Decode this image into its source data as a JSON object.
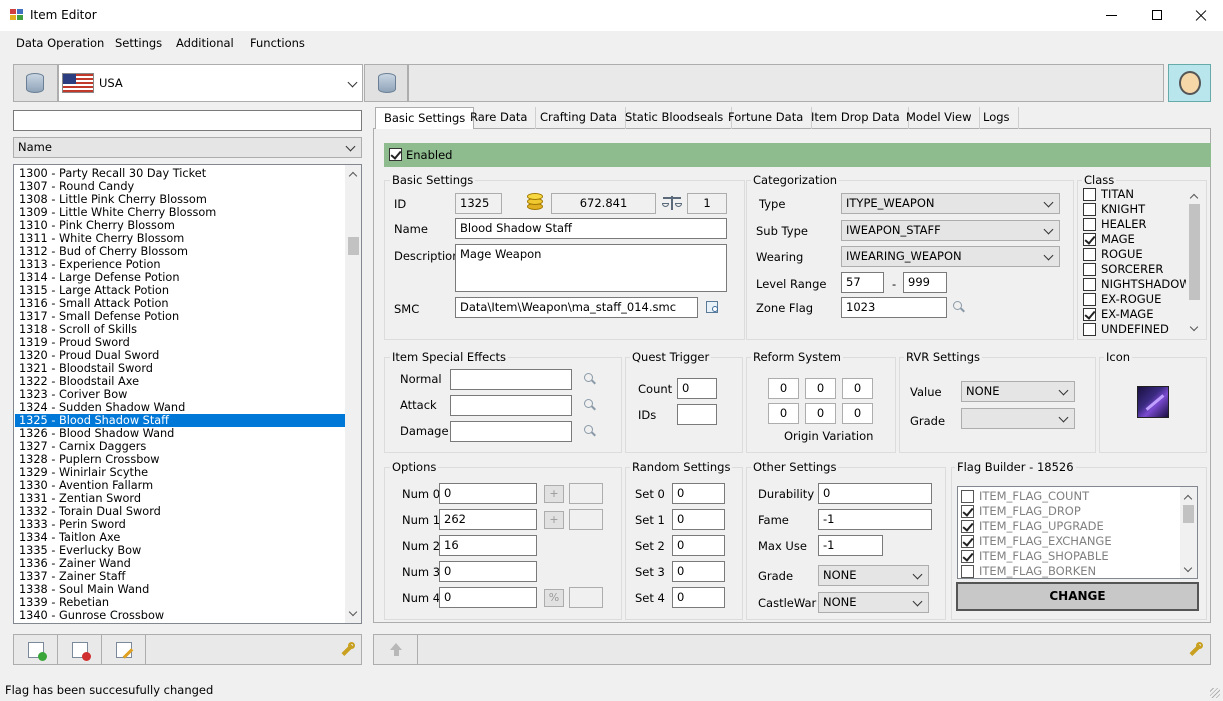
{
  "window": {
    "title": "Item Editor"
  },
  "menu": {
    "items": [
      "Data Operation",
      "Settings",
      "Additional",
      "Functions"
    ]
  },
  "toolbar": {
    "region": "USA"
  },
  "search": {
    "value": ""
  },
  "sort": {
    "selected": "Name"
  },
  "items": [
    "1300 - Party Recall 30 Day Ticket",
    "1307 - Round Candy",
    "1308 - Little Pink Cherry Blossom",
    "1309 - Little White Cherry Blossom",
    "1310 - Pink Cherry Blossom",
    "1311 - White Cherry Blossom",
    "1312 - Bud of Cherry Blossom",
    "1313 - Experience Potion",
    "1314 - Large Defense Potion",
    "1315 - Large Attack Potion",
    "1316 - Small Attack Potion",
    "1317 - Small Defense Potion",
    "1318 - Scroll of Skills",
    "1319 - Proud Sword",
    "1320 - Proud Dual Sword",
    "1321 - Bloodstail Sword",
    "1322 - Bloodstail Axe",
    "1323 - Coriver Bow",
    "1324 - Sudden Shadow Wand",
    "1325 - Blood Shadow Staff",
    "1326 - Blood Shadow Wand",
    "1327 - Carnix Daggers",
    "1328 - Puplern Crossbow",
    "1329 - Winirlair Scythe",
    "1330 - Avention Fallarm",
    "1331 - Zentian Sword",
    "1332 - Torain Dual Sword",
    "1333 - Perin Sword",
    "1334 - Taitlon Axe",
    "1335 - Everlucky Bow",
    "1336 - Zainer Wand",
    "1337 - Zainer Staff",
    "1338 - Soul Main Wand",
    "1339 - Rebetian",
    "1340 - Gunrose Crossbow"
  ],
  "selected_item_index": 19,
  "tabs": [
    "Basic Settings",
    "Rare Data",
    "Crafting Data",
    "Static Bloodseals",
    "Fortune Data",
    "Item Drop Data",
    "Model View",
    "Logs"
  ],
  "enabled": {
    "label": "Enabled",
    "checked": true
  },
  "basic": {
    "group": "Basic Settings",
    "id_label": "ID",
    "id": "1325",
    "price": "672.841",
    "weight": "1",
    "name_label": "Name",
    "name": "Blood Shadow Staff",
    "desc_label": "Description",
    "description": "Mage Weapon",
    "smc_label": "SMC",
    "smc": "Data\\Item\\Weapon\\ma_staff_014.smc"
  },
  "categorization": {
    "group": "Categorization",
    "type_label": "Type",
    "type": "ITYPE_WEAPON",
    "subtype_label": "Sub Type",
    "subtype": "IWEAPON_STAFF",
    "wearing_label": "Wearing",
    "wearing": "IWEARING_WEAPON",
    "level_label": "Level Range",
    "level_min": "57",
    "level_sep": "-",
    "level_max": "999",
    "zone_label": "Zone Flag",
    "zone": "1023"
  },
  "class": {
    "group": "Class",
    "items": [
      {
        "label": "TITAN",
        "checked": false
      },
      {
        "label": "KNIGHT",
        "checked": false
      },
      {
        "label": "HEALER",
        "checked": false
      },
      {
        "label": "MAGE",
        "checked": true
      },
      {
        "label": "ROGUE",
        "checked": false
      },
      {
        "label": "SORCERER",
        "checked": false
      },
      {
        "label": "NIGHTSHADOW",
        "checked": false
      },
      {
        "label": "EX-ROGUE",
        "checked": false
      },
      {
        "label": "EX-MAGE",
        "checked": true
      },
      {
        "label": "UNDEFINED",
        "checked": false
      }
    ]
  },
  "effects": {
    "group": "Item Special Effects",
    "normal_label": "Normal",
    "attack_label": "Attack",
    "damage_label": "Damage",
    "normal": "",
    "attack": "",
    "damage": ""
  },
  "quest": {
    "group": "Quest Trigger",
    "count_label": "Count",
    "count": "0",
    "ids_label": "IDs",
    "ids": ""
  },
  "reform": {
    "group": "Reform System",
    "values": [
      "0",
      "0",
      "0",
      "0",
      "0",
      "0"
    ],
    "caption": "Origin Variation"
  },
  "rvr": {
    "group": "RVR Settings",
    "value_label": "Value",
    "value": "NONE",
    "grade_label": "Grade",
    "grade": ""
  },
  "icon": {
    "group": "Icon"
  },
  "options": {
    "group": "Options",
    "rows": [
      {
        "label": "Num 0",
        "value": "0",
        "btn": "+"
      },
      {
        "label": "Num 1",
        "value": "262",
        "btn": "+"
      },
      {
        "label": "Num 2",
        "value": "16"
      },
      {
        "label": "Num 3",
        "value": "0"
      },
      {
        "label": "Num 4",
        "value": "0",
        "btn": "%"
      }
    ]
  },
  "random": {
    "group": "Random Settings",
    "rows": [
      {
        "label": "Set 0",
        "value": "0"
      },
      {
        "label": "Set 1",
        "value": "0"
      },
      {
        "label": "Set 2",
        "value": "0"
      },
      {
        "label": "Set 3",
        "value": "0"
      },
      {
        "label": "Set 4",
        "value": "0"
      }
    ]
  },
  "other": {
    "group": "Other Settings",
    "durability_label": "Durability",
    "durability": "0",
    "fame_label": "Fame",
    "fame": "-1",
    "maxuse_label": "Max Use",
    "maxuse": "-1",
    "grade_label": "Grade",
    "grade": "NONE",
    "castlewar_label": "CastleWar",
    "castlewar": "NONE"
  },
  "flags": {
    "group": "Flag Builder - 18526",
    "items": [
      {
        "label": "ITEM_FLAG_COUNT",
        "checked": false
      },
      {
        "label": "ITEM_FLAG_DROP",
        "checked": true
      },
      {
        "label": "ITEM_FLAG_UPGRADE",
        "checked": true
      },
      {
        "label": "ITEM_FLAG_EXCHANGE",
        "checked": true
      },
      {
        "label": "ITEM_FLAG_SHOPABLE",
        "checked": true
      },
      {
        "label": "ITEM_FLAG_BORKEN",
        "checked": false
      }
    ],
    "change_label": "CHANGE"
  },
  "status": {
    "text": "Flag has been succesufully changed"
  },
  "colors": {
    "accent": "#0078d7",
    "enabled_bar": "#8fbc8f",
    "avatar_bg": "#b8e6ec"
  }
}
